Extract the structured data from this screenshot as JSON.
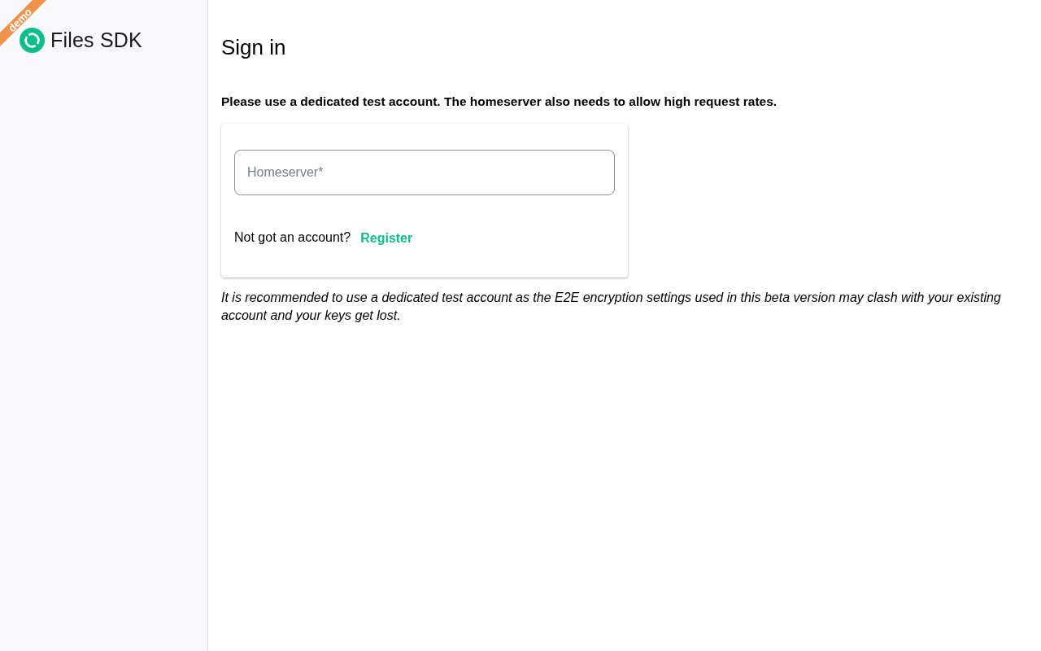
{
  "sidebar": {
    "ribbon": "demo",
    "app_name": "Files SDK"
  },
  "page": {
    "title": "Sign in",
    "notice": "Please use a dedicated test account. The homeserver also needs to allow high request rates.",
    "form": {
      "homeserver": {
        "placeholder": "Homeserver*"
      },
      "register_prompt": "Not got an account?",
      "register_link": "Register"
    },
    "footnote": "It is recommended to use a dedicated test account as the E2E encryption settings used in this beta version may clash with your existing account and your keys get lost."
  }
}
